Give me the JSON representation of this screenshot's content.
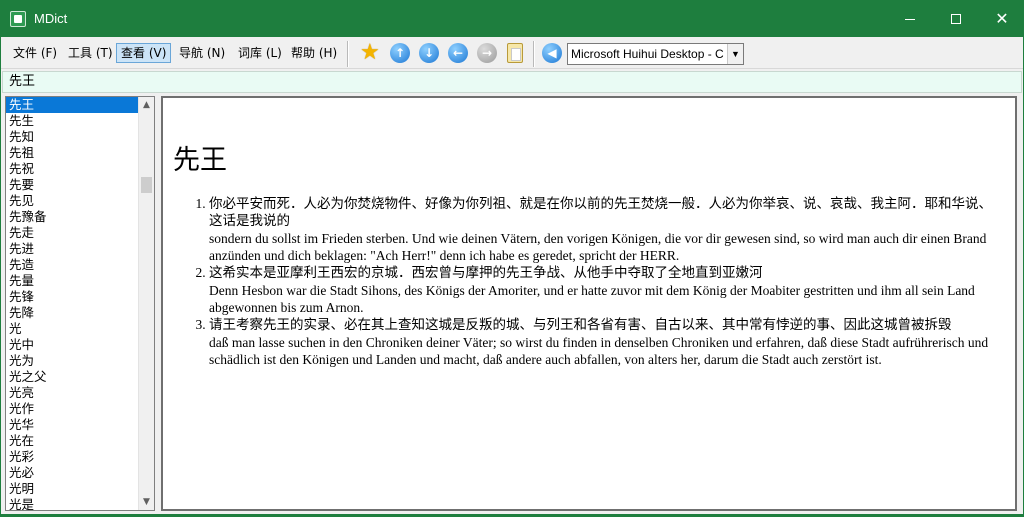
{
  "window": {
    "title": "MDict"
  },
  "menu": [
    {
      "label": "文件 (F)"
    },
    {
      "label": "工具 (T)"
    },
    {
      "label": "查看 (V)"
    },
    {
      "label": "导航 (N)"
    },
    {
      "label": "词库 (L)"
    },
    {
      "label": "帮助 (H)"
    }
  ],
  "toolbar": {
    "icons": [
      "star-icon",
      "arrow-up-icon",
      "arrow-down-icon",
      "arrow-left-icon",
      "arrow-right-icon",
      "clipboard-icon",
      "speaker-icon"
    ],
    "font_select": "Microsoft Huihui Desktop - C"
  },
  "search": {
    "value": "先王"
  },
  "word_list": [
    "先王",
    "先生",
    "先知",
    "先祖",
    "先祝",
    "先要",
    "先见",
    "先豫备",
    "先走",
    "先进",
    "先造",
    "先量",
    "先锋",
    "先降",
    "光",
    "光中",
    "光为",
    "光之父",
    "光亮",
    "光作",
    "光华",
    "光在",
    "光彩",
    "光必",
    "光明",
    "光是"
  ],
  "definition": {
    "headword": "先王",
    "entries": [
      {
        "zh": "你必平安而死．人必为你焚烧物件、好像为你列祖、就是在你以前的先王焚烧一般．人必为你举哀、说、哀哉、我主阿．耶和华说、这话是我说的",
        "de": "sondern du sollst im Frieden sterben. Und wie deinen Vätern, den vorigen Königen, die vor dir gewesen sind, so wird man auch dir einen Brand anzünden und dich beklagen: \"Ach Herr!\" denn ich habe es geredet, spricht der HERR."
      },
      {
        "zh": "这希实本是亚摩利王西宏的京城．西宏曾与摩押的先王争战、从他手中夺取了全地直到亚嫩河",
        "de": "Denn Hesbon war die Stadt Sihons, des Königs der Amoriter, und er hatte zuvor mit dem König der Moabiter gestritten und ihm all sein Land abgewonnen bis zum Arnon."
      },
      {
        "zh": "请王考察先王的实录、必在其上查知这城是反叛的城、与列王和各省有害、自古以来、其中常有悖逆的事、因此这城曾被拆毁",
        "de": "daß man lasse suchen in den Chroniken deiner Väter; so wirst du finden in denselben Chroniken und erfahren, daß diese Stadt aufrührerisch und schädlich ist den Königen und Landen und macht, daß andere auch abfallen, von alters her, darum die Stadt auch zerstört ist."
      }
    ]
  },
  "colors": {
    "title_bar": "#1e7e3e",
    "selection": "#0a78d7",
    "search_bg": "#e9fbf4"
  }
}
